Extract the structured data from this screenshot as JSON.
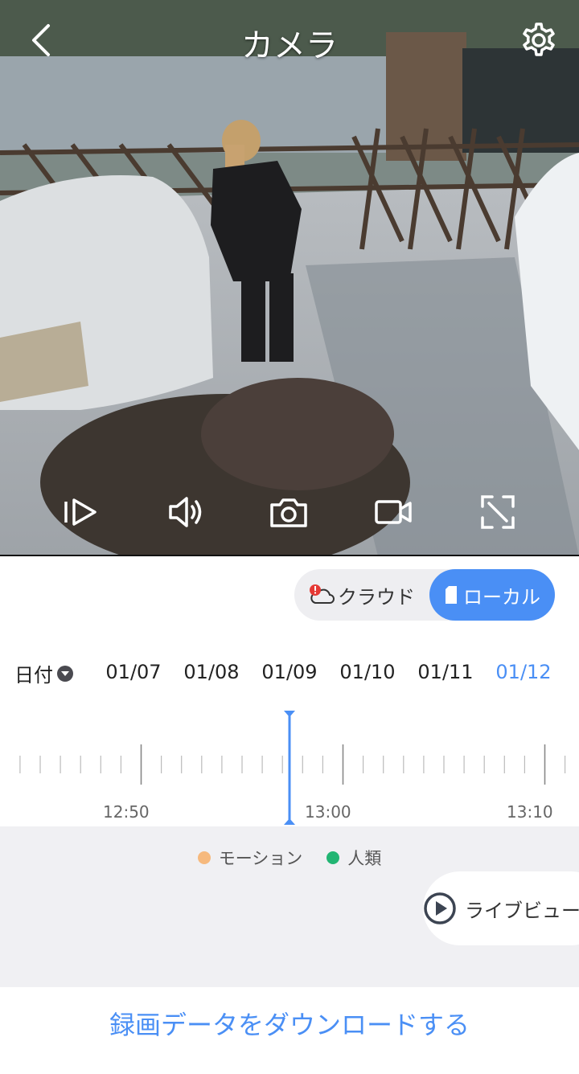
{
  "header": {
    "title": "カメラ"
  },
  "icons": {
    "back": "chevron-left-icon",
    "settings": "gear-icon",
    "controls": [
      "playback-icon",
      "speaker-icon",
      "camera-icon",
      "video-record-icon",
      "fullscreen-icon"
    ]
  },
  "source_toggle": {
    "cloud_label": "クラウド",
    "local_label": "ローカル",
    "selected": "local"
  },
  "date_selector": {
    "label": "日付",
    "dates": [
      "01/07",
      "01/08",
      "01/09",
      "01/10",
      "01/11",
      "01/12"
    ],
    "selected": "01/12"
  },
  "timeline": {
    "labels": [
      "12:50",
      "13:00",
      "13:10"
    ]
  },
  "legend": {
    "motion": "モーション",
    "human": "人類",
    "motion_color": "#f6b97d",
    "human_color": "#22b573"
  },
  "live_view": {
    "label": "ライブビュー"
  },
  "download": {
    "label": "録画データをダウンロードする"
  },
  "colors": {
    "accent": "#4a8ff5",
    "alert": "#e53935"
  }
}
